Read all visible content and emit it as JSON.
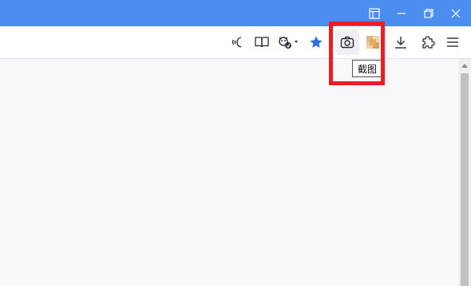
{
  "window": {
    "title_color": "#4c8ef0",
    "controls": [
      {
        "name": "tab-layout-icon"
      },
      {
        "name": "minimize-icon"
      },
      {
        "name": "restore-icon"
      },
      {
        "name": "close-icon"
      }
    ]
  },
  "toolbar": {
    "buttons": [
      {
        "name": "read-aloud-icon"
      },
      {
        "name": "reader-view-icon"
      },
      {
        "name": "privacy-shield-icon"
      },
      {
        "name": "bookmark-star-icon"
      },
      {
        "name": "screenshot-camera-icon"
      },
      {
        "name": "extension-avatar-icon"
      },
      {
        "name": "downloads-icon"
      },
      {
        "name": "extensions-puzzle-icon"
      },
      {
        "name": "menu-hamburger-icon"
      }
    ],
    "accent_star": "#2f6ce5"
  },
  "tooltip": {
    "text": "截图"
  },
  "highlight": {
    "color": "#ee1c25"
  }
}
